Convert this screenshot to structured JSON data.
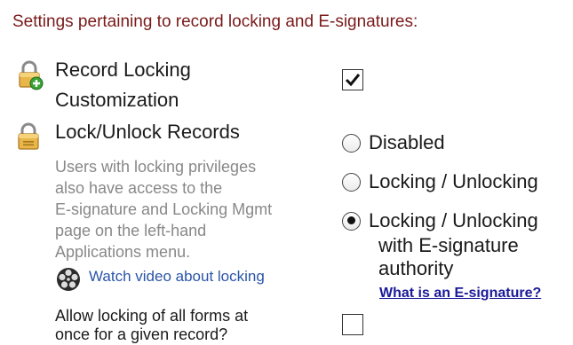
{
  "header": "Settings pertaining to record locking and E-signatures:",
  "record_locking": {
    "label_line1": "Record Locking",
    "label_line2": "Customization",
    "icon": "lock-add-icon",
    "checked": true
  },
  "lock_unlock": {
    "label": "Lock/Unlock Records",
    "icon": "padlock-icon",
    "description": [
      "Users with locking privileges",
      "also have access to the",
      "E-signature and Locking Mgmt",
      "page on the left-hand",
      "Applications menu."
    ],
    "video_link": "Watch video about locking",
    "video_icon": "film-reel-icon",
    "options": [
      {
        "label": "Disabled",
        "selected": false
      },
      {
        "label": "Locking / Unlocking",
        "selected": false
      },
      {
        "label": "Locking / Unlocking",
        "sub": [
          "with E-signature",
          "authority"
        ],
        "selected": true
      }
    ],
    "help_link": "What is an E-signature?"
  },
  "allow_all_forms": {
    "label_line1": "Allow locking of all forms at",
    "label_line2": "once for a given record?",
    "checked": false
  }
}
